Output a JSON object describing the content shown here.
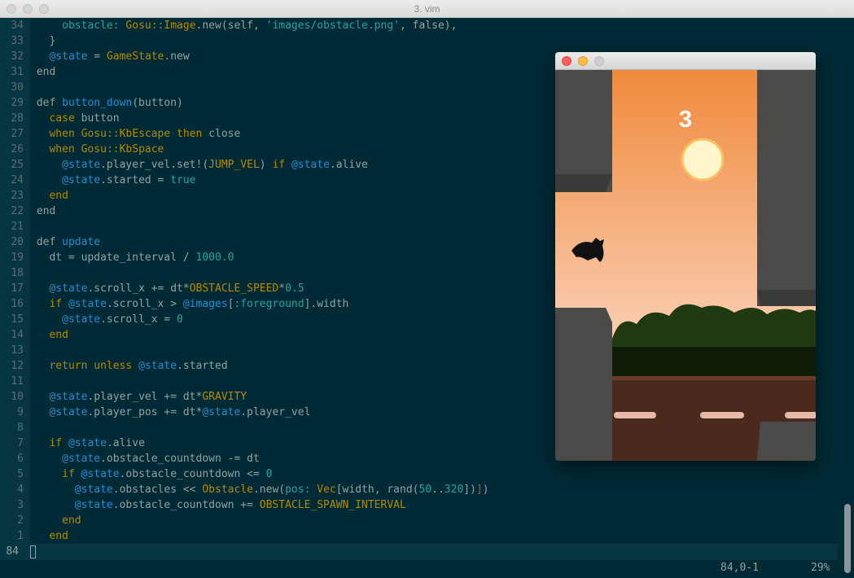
{
  "window": {
    "title": "3. vim"
  },
  "editor": {
    "lines": [
      {
        "num": "34",
        "tokens": [
          [
            "    ",
            ""
          ],
          [
            "obstacle: ",
            "s"
          ],
          [
            "Gosu",
            "t"
          ],
          [
            "::",
            "k"
          ],
          [
            "Image",
            "t"
          ],
          [
            ".new(self, ",
            ""
          ],
          [
            "'images/obstacle.png'",
            "s"
          ],
          [
            ", false),",
            ""
          ]
        ]
      },
      {
        "num": "33",
        "tokens": [
          [
            "  }",
            ""
          ]
        ]
      },
      {
        "num": "32",
        "tokens": [
          [
            "  ",
            ""
          ],
          [
            "@state",
            "i"
          ],
          [
            " = ",
            ""
          ],
          [
            "GameState",
            "t"
          ],
          [
            ".new",
            ""
          ]
        ]
      },
      {
        "num": "31",
        "tokens": [
          [
            "end",
            ""
          ]
        ]
      },
      {
        "num": "30",
        "tokens": []
      },
      {
        "num": "29",
        "tokens": [
          [
            "def ",
            ""
          ],
          [
            "button_down",
            "f"
          ],
          [
            "(button)",
            ""
          ]
        ]
      },
      {
        "num": "28",
        "tokens": [
          [
            "  ",
            ""
          ],
          [
            "case",
            "t"
          ],
          [
            " button",
            ""
          ]
        ]
      },
      {
        "num": "27",
        "tokens": [
          [
            "  ",
            ""
          ],
          [
            "when",
            "t"
          ],
          [
            " ",
            ""
          ],
          [
            "Gosu",
            "t"
          ],
          [
            "::",
            "k"
          ],
          [
            "KbEscape",
            "t"
          ],
          [
            " ",
            ""
          ],
          [
            "then",
            "t"
          ],
          [
            " close",
            ""
          ]
        ]
      },
      {
        "num": "26",
        "tokens": [
          [
            "  ",
            ""
          ],
          [
            "when",
            "t"
          ],
          [
            " ",
            ""
          ],
          [
            "Gosu",
            "t"
          ],
          [
            "::",
            "k"
          ],
          [
            "KbSpace",
            "t"
          ]
        ]
      },
      {
        "num": "25",
        "tokens": [
          [
            "    ",
            ""
          ],
          [
            "@state",
            "i"
          ],
          [
            ".player_vel.set!(",
            ""
          ],
          [
            "JUMP_VEL",
            "t"
          ],
          [
            ") ",
            ""
          ],
          [
            "if",
            "t"
          ],
          [
            " ",
            ""
          ],
          [
            "@state",
            "i"
          ],
          [
            ".alive",
            ""
          ]
        ]
      },
      {
        "num": "24",
        "tokens": [
          [
            "    ",
            ""
          ],
          [
            "@state",
            "i"
          ],
          [
            ".started = ",
            ""
          ],
          [
            "true",
            "s"
          ]
        ]
      },
      {
        "num": "23",
        "tokens": [
          [
            "  ",
            ""
          ],
          [
            "end",
            "t"
          ]
        ]
      },
      {
        "num": "22",
        "tokens": [
          [
            "end",
            ""
          ]
        ]
      },
      {
        "num": "21",
        "tokens": []
      },
      {
        "num": "20",
        "tokens": [
          [
            "def ",
            ""
          ],
          [
            "update",
            "f"
          ]
        ]
      },
      {
        "num": "19",
        "tokens": [
          [
            "  dt = update_interval / ",
            ""
          ],
          [
            "1000.0",
            "s"
          ]
        ]
      },
      {
        "num": "18",
        "tokens": []
      },
      {
        "num": "17",
        "tokens": [
          [
            "  ",
            ""
          ],
          [
            "@state",
            "i"
          ],
          [
            ".scroll_x += dt*",
            ""
          ],
          [
            "OBSTACLE_SPEED",
            "t"
          ],
          [
            "*",
            ""
          ],
          [
            "0.5",
            "s"
          ]
        ]
      },
      {
        "num": "16",
        "tokens": [
          [
            "  ",
            ""
          ],
          [
            "if",
            "t"
          ],
          [
            " ",
            ""
          ],
          [
            "@state",
            "i"
          ],
          [
            ".scroll_x > ",
            ""
          ],
          [
            "@images",
            "i"
          ],
          [
            "[",
            ""
          ],
          [
            ":foreground",
            "s"
          ],
          [
            "].width",
            ""
          ]
        ]
      },
      {
        "num": "15",
        "tokens": [
          [
            "    ",
            ""
          ],
          [
            "@state",
            "i"
          ],
          [
            ".scroll_x = ",
            ""
          ],
          [
            "0",
            "s"
          ]
        ]
      },
      {
        "num": "14",
        "tokens": [
          [
            "  ",
            ""
          ],
          [
            "end",
            "t"
          ]
        ]
      },
      {
        "num": "13",
        "tokens": []
      },
      {
        "num": "12",
        "tokens": [
          [
            "  ",
            ""
          ],
          [
            "return",
            "t"
          ],
          [
            " ",
            ""
          ],
          [
            "unless",
            "t"
          ],
          [
            " ",
            ""
          ],
          [
            "@state",
            "i"
          ],
          [
            ".started",
            ""
          ]
        ]
      },
      {
        "num": "11",
        "tokens": []
      },
      {
        "num": "10",
        "tokens": [
          [
            "  ",
            ""
          ],
          [
            "@state",
            "i"
          ],
          [
            ".player_vel += dt*",
            ""
          ],
          [
            "GRAVITY",
            "t"
          ]
        ]
      },
      {
        "num": "9",
        "tokens": [
          [
            "  ",
            ""
          ],
          [
            "@state",
            "i"
          ],
          [
            ".player_pos += dt*",
            ""
          ],
          [
            "@state",
            "i"
          ],
          [
            ".player_vel",
            ""
          ]
        ]
      },
      {
        "num": "8",
        "tokens": []
      },
      {
        "num": "7",
        "tokens": [
          [
            "  ",
            ""
          ],
          [
            "if",
            "t"
          ],
          [
            " ",
            ""
          ],
          [
            "@state",
            "i"
          ],
          [
            ".alive",
            ""
          ]
        ]
      },
      {
        "num": "6",
        "tokens": [
          [
            "    ",
            ""
          ],
          [
            "@state",
            "i"
          ],
          [
            ".obstacle_countdown -= dt",
            ""
          ]
        ]
      },
      {
        "num": "5",
        "tokens": [
          [
            "    ",
            ""
          ],
          [
            "if",
            "t"
          ],
          [
            " ",
            ""
          ],
          [
            "@state",
            "i"
          ],
          [
            ".obstacle_countdown <= ",
            ""
          ],
          [
            "0",
            "s"
          ]
        ]
      },
      {
        "num": "4",
        "tokens": [
          [
            "      ",
            ""
          ],
          [
            "@state",
            "i"
          ],
          [
            ".obstacles << ",
            ""
          ],
          [
            "Obstacle",
            "t"
          ],
          [
            ".new(",
            ""
          ],
          [
            "pos:",
            "s"
          ],
          [
            " ",
            ""
          ],
          [
            "Vec",
            "t"
          ],
          [
            "[width, rand(",
            ""
          ],
          [
            "50",
            "s"
          ],
          [
            "..",
            ""
          ],
          [
            "320",
            "s"
          ],
          [
            "])",
            ""
          ],
          [
            "]",
            "c"
          ],
          [
            ")",
            ""
          ]
        ]
      },
      {
        "num": "3",
        "tokens": [
          [
            "      ",
            ""
          ],
          [
            "@state",
            "i"
          ],
          [
            ".obstacle_countdown += ",
            ""
          ],
          [
            "OBSTACLE_SPAWN_INTERVAL",
            "t"
          ]
        ]
      },
      {
        "num": "2",
        "tokens": [
          [
            "    ",
            ""
          ],
          [
            "end",
            "t"
          ]
        ]
      },
      {
        "num": "1",
        "tokens": [
          [
            "  ",
            ""
          ],
          [
            "end",
            "t"
          ]
        ]
      }
    ],
    "current_line_number": "84"
  },
  "status": {
    "position": "84,0-1",
    "percent": "29%"
  },
  "game": {
    "score": "3",
    "colors": {
      "sky_top": "#f08a3c",
      "sky_bottom": "#fbd8c4",
      "sun": "#fff6cc",
      "rock": "#4a4a48",
      "dirt": "#4a2a1c",
      "stripe": "#e8b8a8",
      "trees": "#1f3a10"
    }
  }
}
